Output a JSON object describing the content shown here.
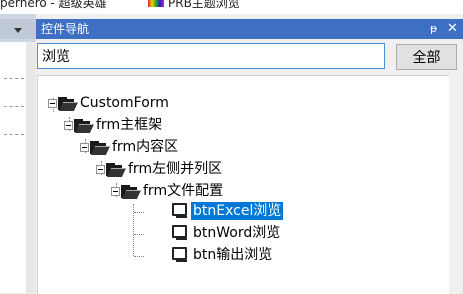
{
  "background_window": {
    "text_left": "perhero - 超级英雄",
    "text_right": "PRB主题浏览"
  },
  "panel": {
    "title": "控件导航",
    "pin_glyph": "ᵽ",
    "close_glyph": "✕"
  },
  "search": {
    "value": "浏览"
  },
  "all_button_label": "全部",
  "tree": {
    "root": "CustomForm",
    "n1": "frm主框架",
    "n2": "frm内容区",
    "n3": "frm左侧并列区",
    "n4": "frm文件配置",
    "leaves": [
      "btnExcel浏览",
      "btnWord浏览",
      "btn输出浏览"
    ],
    "selected_index": 0
  },
  "colors": {
    "title_bar": "#3d6fc3",
    "selection": "#0078d7",
    "focus_border": "#4a90d9"
  }
}
